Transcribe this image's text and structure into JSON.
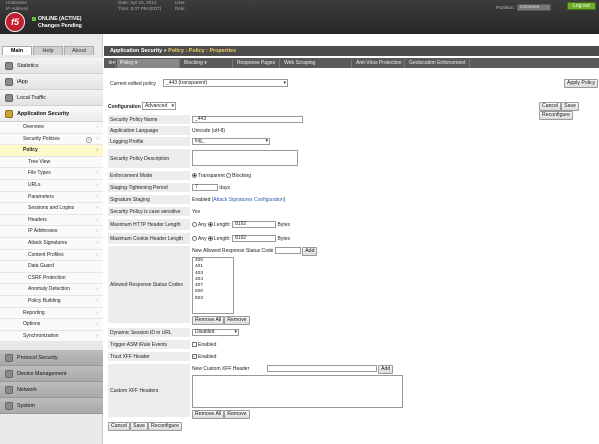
{
  "header": {
    "hostname_label": "Hostname",
    "ip_label": "IP Address",
    "date_label": "Date:",
    "date_value": "Apr 23, 2014",
    "time_label": "Time:",
    "time_value": "5:07 PM (EDT)",
    "user_label": "User:",
    "role_label": "Role:",
    "status_line1": "ONLINE (ACTIVE)",
    "status_line2": "Changes Pending",
    "partition_label": "Partition:",
    "partition_value": "Common",
    "logout_label": "Log out",
    "logo_text": "f5"
  },
  "sidebar": {
    "tabs": [
      "Main",
      "Help",
      "About"
    ],
    "sections": [
      "Statistics",
      "iApp",
      "Local Traffic",
      "Application Security"
    ],
    "app_security_items": [
      "Overview",
      "Security Policies",
      "Policy",
      "Tree View",
      "File Types",
      "URLs",
      "Parameters",
      "Sessions and Logins",
      "Headers",
      "IP Addresses",
      "Attack Signatures",
      "Content Profiles",
      "Data Guard",
      "CSRF Protection",
      "Anomaly Detection",
      "Policy Building",
      "Reporting",
      "Options",
      "Synchronization"
    ],
    "bottom_sections": [
      "Protocol Security",
      "Device Management",
      "Network",
      "System"
    ]
  },
  "main": {
    "breadcrumb_prefix": "Application Security",
    "breadcrumb_sep": "»",
    "breadcrumb_link": "Policy : Policy : Properties",
    "tabs": [
      "Policy",
      "Blocking",
      "Response Pages",
      "Web Scraping",
      "Anti-Virus Protection",
      "Geolocation Enforcement"
    ],
    "current_policy_label": "Current edited policy",
    "current_policy_value": "_443 (transparent)",
    "apply_policy_label": "Apply Policy",
    "configuration_label": "Configuration",
    "configuration_value": "Advanced",
    "cancel_label": "Cancel",
    "save_label": "Save",
    "reconfigure_label": "Reconfigure",
    "fields": {
      "policy_name_label": "Security Policy Name",
      "policy_name_value": "_443",
      "app_language_label": "Application Language",
      "app_language_value": "Unicode (utf-8)",
      "logging_profile_label": "Logging Profile",
      "logging_profile_value": "log_",
      "description_label": "Security Policy Description",
      "enforcement_label": "Enforcement Mode",
      "enforcement_transparent": "Transparent",
      "enforcement_blocking": "Blocking",
      "staging_label": "Staging-Tightening Period",
      "staging_value": "7",
      "staging_unit": "days",
      "sig_staging_label": "Signature Staging",
      "sig_staging_value": "Enabled (",
      "sig_staging_link": "Attack Signatures Configuration",
      "sig_staging_close": ")",
      "case_label": "Security Policy is case sensitive",
      "case_value": "Yes",
      "max_http_label": "Maximum HTTP Header Length",
      "max_cookie_label": "Maximum Cookie Header Length",
      "any_label": "Any",
      "length_label": "Length:",
      "http_length": "8192",
      "cookie_length": "8192",
      "bytes_label": "Bytes",
      "allowed_codes_label": "Allowed Response Status Codes",
      "new_code_label": "New Allowed Response Status Code",
      "add_label": "Add",
      "codes": [
        "400",
        "401",
        "403",
        "404",
        "407",
        "500",
        "503"
      ],
      "remove_all_label": "Remove All",
      "remove_label": "Remove",
      "dynamic_session_label": "Dynamic Session ID in URL",
      "dynamic_session_value": "Disabled",
      "trigger_label": "Trigger ASM iRule Events",
      "trigger_value": "Enabled",
      "trust_xff_label": "Trust XFF Header",
      "trust_xff_value": "Enabled",
      "custom_xff_label": "Custom XFF Headers",
      "new_xff_label": "New Custom XFF Header"
    }
  },
  "colors": {
    "topbar": "#2f2f2f",
    "logo": "#c41f2d",
    "status_ok": "#6cbf3b",
    "logout": "#6fad2c",
    "breadcrumb_link": "#f7cc66",
    "selected_nav": "#fff8c8",
    "link": "#2a5db0"
  }
}
